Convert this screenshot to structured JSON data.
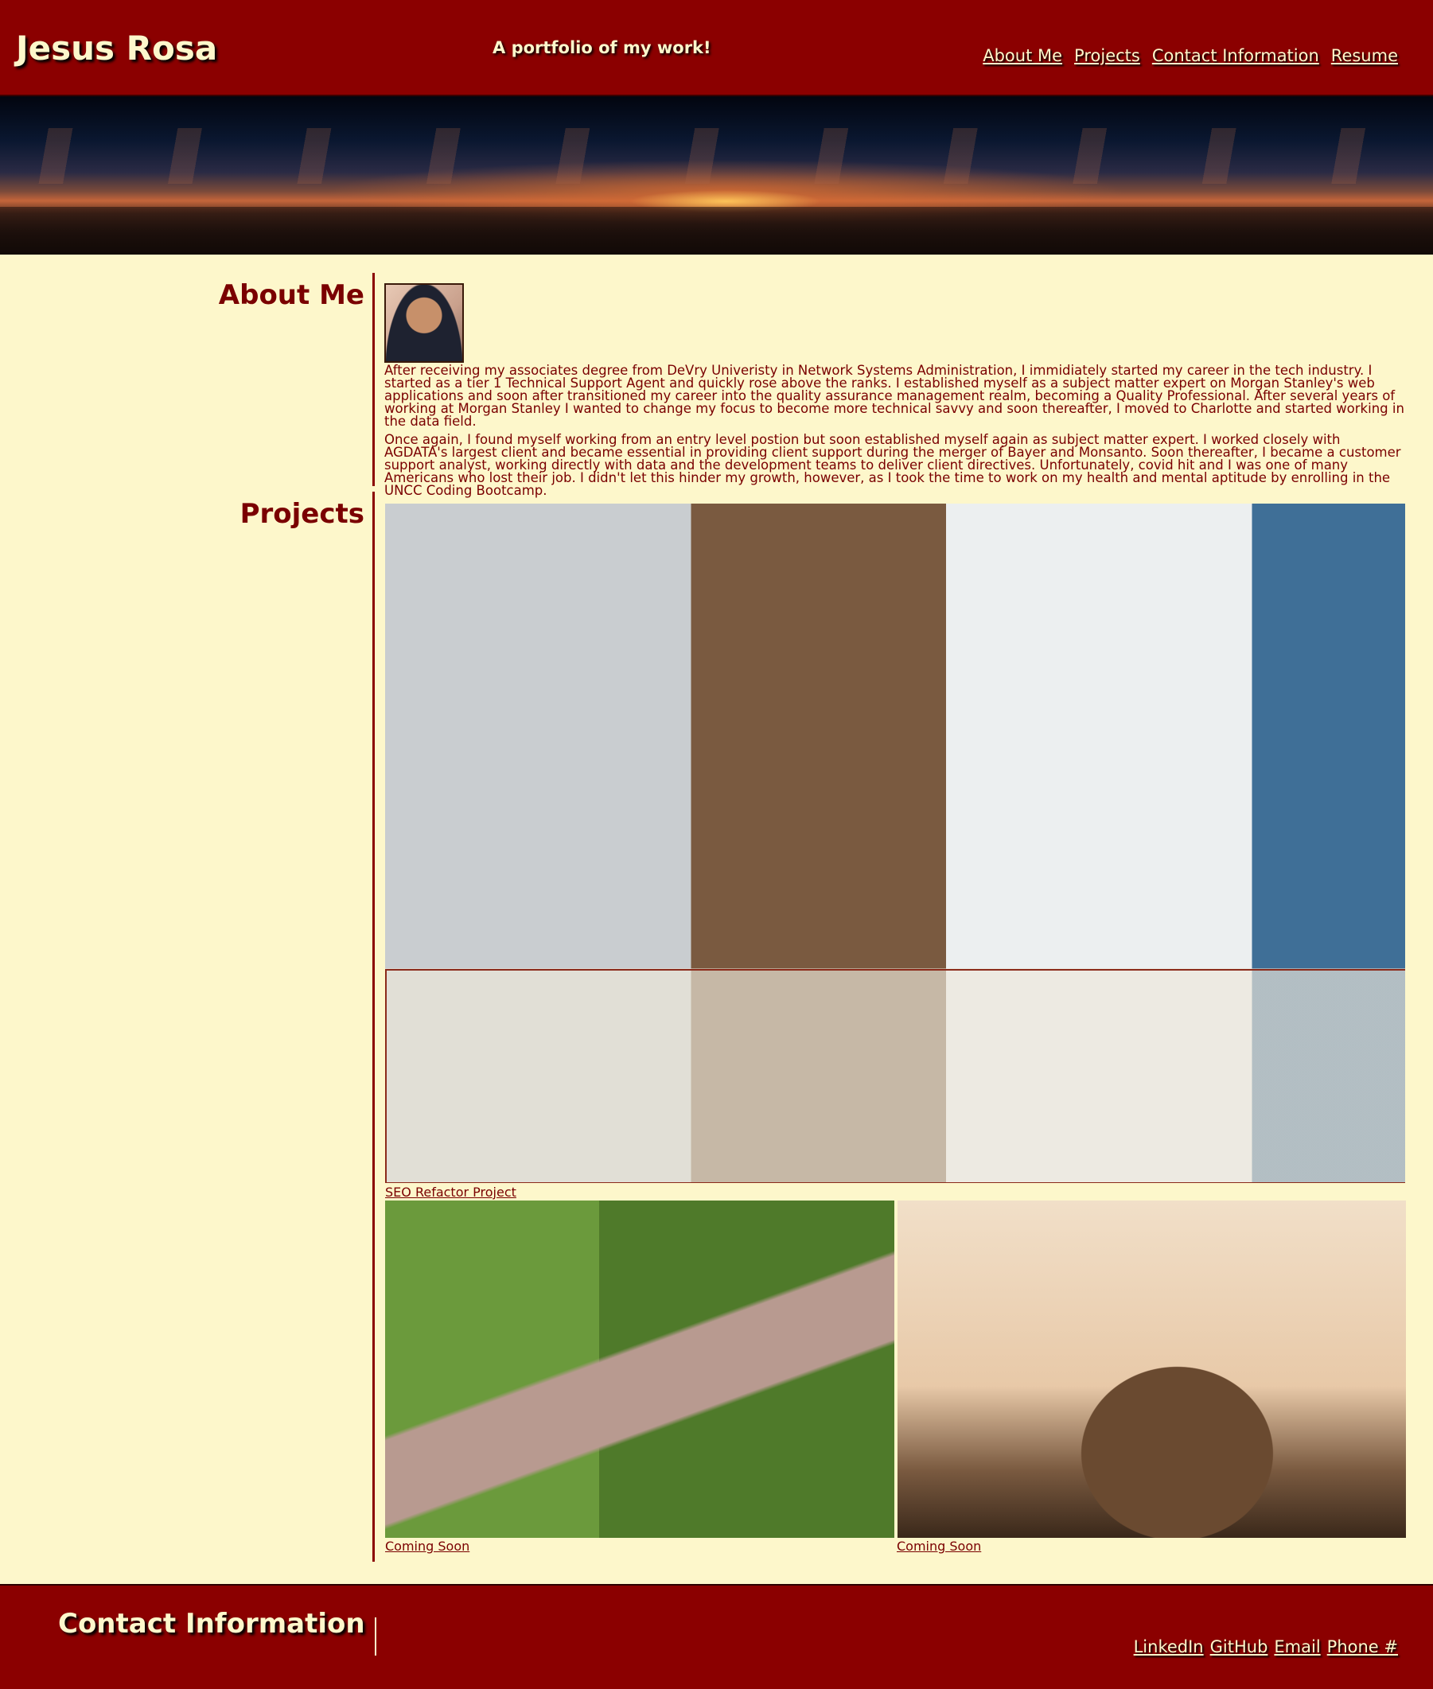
{
  "header": {
    "title": "Jesus Rosa",
    "tagline": "A portfolio of my work!",
    "nav": [
      "About Me",
      "Projects",
      "Contact Information",
      "Resume"
    ]
  },
  "about": {
    "heading": "About Me",
    "paragraphs": [
      "After receiving my associates degree from DeVry Univeristy in Network Systems Administration, I immidiately started my career in the tech industry. I started as a tier 1 Technical Support Agent and quickly rose above the ranks. I established myself as a subject matter expert on Morgan Stanley's web applications and soon after transitioned my career into the quality assurance management realm, becoming a Quality Professional. After several years of working at Morgan Stanley I wanted to change my focus to become more technical savvy and soon thereafter, I moved to Charlotte and started working in the data field.",
      "Once again, I found myself working from an entry level postion but soon established myself again as subject matter expert. I worked closely with AGDATA's largest client and became essential in providing client support during the merger of Bayer and Monsanto. Soon thereafter, I became a customer support analyst, working directly with data and the development teams to deliver client directives. Unfortunately, covid hit and I was one of many Americans who lost their job. I didn't let this hinder my growth, however, as I took the time to work on my health and mental aptitude by enrolling in the UNCC Coding Bootcamp."
    ]
  },
  "projects": {
    "heading": "Projects",
    "items": [
      {
        "label": "SEO Refactor Project"
      },
      {
        "label": "Coming Soon"
      },
      {
        "label": "Coming Soon"
      }
    ]
  },
  "footer": {
    "title": "Contact Information",
    "links": [
      "LinkedIn",
      "GitHub",
      "Email",
      "Phone #"
    ]
  },
  "colors": {
    "primary": "#8b0000",
    "background": "#fdf7cb",
    "text_accent": "#7a0000"
  }
}
